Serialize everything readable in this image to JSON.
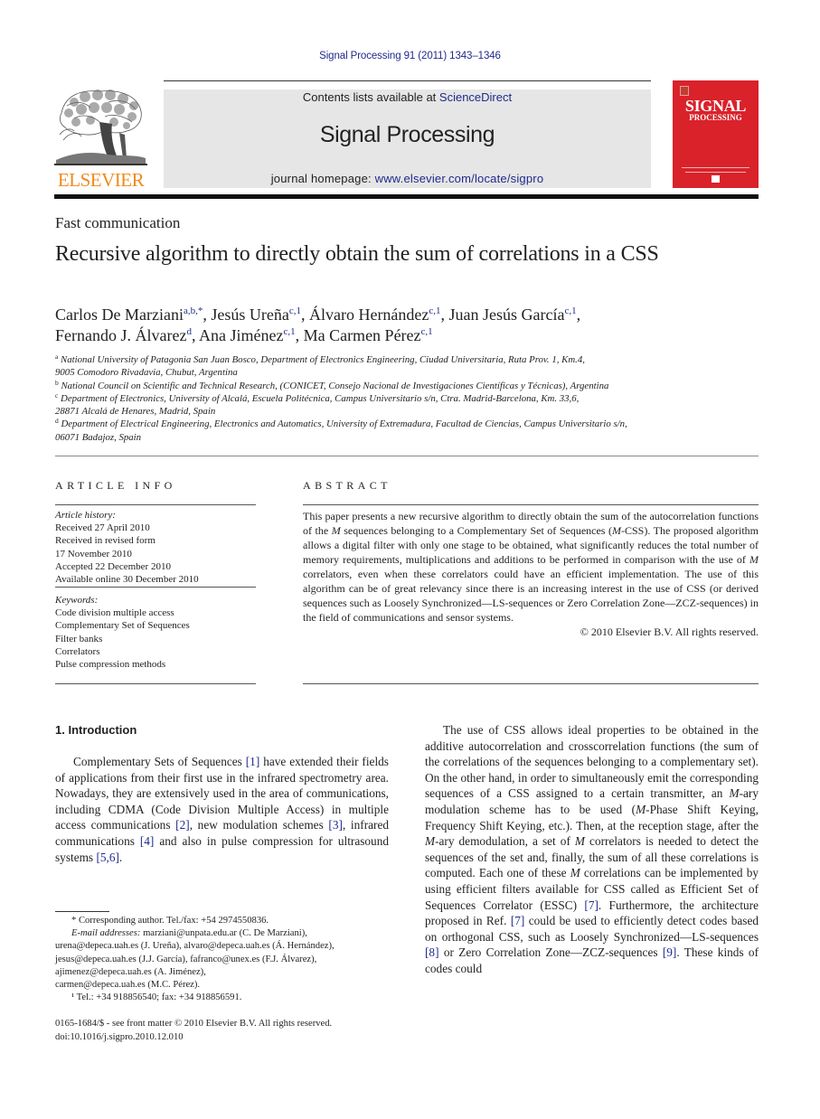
{
  "header": {
    "citation": "Signal Processing 91 (2011) 1343–1346",
    "contents_prefix": "Contents lists available at ",
    "contents_link": "ScienceDirect",
    "journal_title": "Signal Processing",
    "homepage_prefix": "journal homepage: ",
    "homepage_link": "www.elsevier.com/locate/sigpro",
    "publisher_logo_text": "ELSEVIER",
    "cover_title_line1": "SIGNAL",
    "cover_title_line2": "PROCESSING"
  },
  "article": {
    "section_type": "Fast communication",
    "title": "Recursive algorithm to directly obtain the sum of correlations in a CSS",
    "authors_line1": [
      {
        "name": "Carlos De Marziani",
        "sup": "a,b,",
        "star": "*",
        "sep": ", "
      },
      {
        "name": "Jesús Ureña",
        "sup": "c,1",
        "sep": ", "
      },
      {
        "name": "Álvaro Hernández",
        "sup": "c,1",
        "sep": ", "
      },
      {
        "name": "Juan Jesús García",
        "sup": "c,1",
        "sep": ","
      }
    ],
    "authors_line2": [
      {
        "name": "Fernando J. Álvarez",
        "sup": "d",
        "sep": ", "
      },
      {
        "name": "Ana Jiménez",
        "sup": "c,1",
        "sep": ", "
      },
      {
        "name": "Ma Carmen Pérez",
        "sup": "c,1",
        "sep": ""
      }
    ],
    "affiliations": [
      {
        "key": "a",
        "line1": "National University of Patagonia San Juan Bosco, Department of Electronics Engineering, Ciudad Universitaria, Ruta Prov. 1, Km.4,",
        "line2": "9005 Comodoro Rivadavia, Chubut, Argentina"
      },
      {
        "key": "b",
        "line1": "National Council on Scientific and Technical Research, (CONICET, Consejo Nacional de Investigaciones Científicas y Técnicas), Argentina",
        "line2": ""
      },
      {
        "key": "c",
        "line1": "Department of Electronics, University of Alcalá, Escuela Politécnica, Campus Universitario s/n, Ctra. Madrid-Barcelona, Km. 33,6,",
        "line2": "28871 Alcalá de Henares, Madrid, Spain"
      },
      {
        "key": "d",
        "line1": "Department of Electrical Engineering, Electronics and Automatics, University of Extremadura, Facultad de Ciencias, Campus Universitario s/n,",
        "line2": "06071 Badajoz, Spain"
      }
    ]
  },
  "article_info": {
    "heading": "ARTICLE INFO",
    "history_label": "Article history:",
    "history": [
      "Received 27 April 2010",
      "Received in revised form",
      "17 November 2010",
      "Accepted 22 December 2010",
      "Available online 30 December 2010"
    ],
    "keywords_label": "Keywords:",
    "keywords": [
      "Code division multiple access",
      "Complementary Set of Sequences",
      "Filter banks",
      "Correlators",
      "Pulse compression methods"
    ]
  },
  "abstract": {
    "heading": "ABSTRACT",
    "p1": "This paper presents a new recursive algorithm to directly obtain the sum of the autocorrelation functions of the ",
    "m1": "M",
    "p2": " sequences belonging to a Complementary Set of Sequences (",
    "m2": "M",
    "p3": "-CSS). The proposed algorithm allows a digital filter with only one stage to be obtained, what significantly reduces the total number of memory requirements, multiplications and additions to be performed in comparison with the use of ",
    "m3": "M",
    "p4": " correlators, even when these correlators could have an efficient implementation. The use of this algorithm can be of great relevancy since there is an increasing interest in the use of CSS (or derived sequences such as Loosely Synchronized—LS-sequences or Zero Correlation Zone—ZCZ-sequences) in the field of communications and sensor systems.",
    "copyright": "© 2010 Elsevier B.V. All rights reserved."
  },
  "intro": {
    "heading": "1.  Introduction",
    "col1": [
      {
        "t": "Complementary Sets of Sequences "
      },
      {
        "ref": "[1]"
      },
      {
        "t": " have extended their fields of applications from their first use in the infrared spectrometry area. Nowadays, they are extensively used in the area of communications, including CDMA (Code Division Multiple Access) in multiple access communications "
      },
      {
        "ref": "[2]"
      },
      {
        "t": ", new modulation schemes "
      },
      {
        "ref": "[3]"
      },
      {
        "t": ", infrared communications "
      },
      {
        "ref": "[4]"
      },
      {
        "t": " and also in pulse compression for ultrasound systems "
      },
      {
        "ref": "[5,6]"
      },
      {
        "t": "."
      }
    ],
    "col2": [
      {
        "t": "The use of CSS allows ideal properties to be obtained in the additive autocorrelation and crosscorrelation functions (the sum of the correlations of the sequences belonging to a complementary set). On the other hand, in order to simultaneously emit the corresponding sequences of a CSS assigned to a certain transmitter, an "
      },
      {
        "i": "M"
      },
      {
        "t": "-ary modulation scheme has to be used ("
      },
      {
        "i": "M"
      },
      {
        "t": "-Phase Shift Keying, Frequency Shift Keying, etc.). Then, at the reception stage, after the "
      },
      {
        "i": "M"
      },
      {
        "t": "-ary demodulation, a set of "
      },
      {
        "i": "M"
      },
      {
        "t": " correlators is needed to detect the sequences of the set and, finally, the sum of all these correlations is computed. Each one of these "
      },
      {
        "i": "M"
      },
      {
        "t": " correlations can be implemented by using efficient filters available for CSS called as Efficient Set of Sequences Correlator (ESSC) "
      },
      {
        "ref": "[7]"
      },
      {
        "t": ". Furthermore, the architecture proposed in Ref. "
      },
      {
        "ref": "[7]"
      },
      {
        "t": " could be used to efficiently detect codes based on orthogonal CSS, such as Loosely Synchronized—LS-sequences "
      },
      {
        "ref": "[8]"
      },
      {
        "t": " or Zero Correlation Zone—ZCZ-sequences "
      },
      {
        "ref": "[9]"
      },
      {
        "t": ". These kinds of codes could"
      }
    ]
  },
  "footnotes": {
    "corresponding": "* Corresponding author. Tel./fax: +54 2974550836.",
    "email_label": "E-mail addresses:",
    "emails": [
      {
        "addr": "marziani@unpata.edu.ar",
        "who": " (C. De Marziani),"
      },
      {
        "addr": "urena@depeca.uah.es",
        "who": " (J. Ureña), "
      },
      {
        "addr": "alvaro@depeca.uah.es",
        "who": " (Á. Hernández),"
      },
      {
        "addr": "jesus@depeca.uah.es",
        "who": " (J.J. García), "
      },
      {
        "addr": "fafranco@unex.es",
        "who": " (F.J. Álvarez),"
      },
      {
        "addr": "ajimenez@depeca.uah.es",
        "who": " (A. Jiménez),"
      },
      {
        "addr": "carmen@depeca.uah.es",
        "who": " (M.C. Pérez)."
      }
    ],
    "note1": "¹ Tel.: +34 918856540; fax: +34 918856591.",
    "front_matter": "0165-1684/$ - see front matter © 2010 Elsevier B.V. All rights reserved.",
    "doi": "doi:10.1016/j.sigpro.2010.12.010"
  },
  "colors": {
    "link": "#1f2a8c",
    "elsevier_orange": "#f08a1e",
    "cover_red": "#d9222a",
    "banner_gray": "#e6e6e6"
  }
}
